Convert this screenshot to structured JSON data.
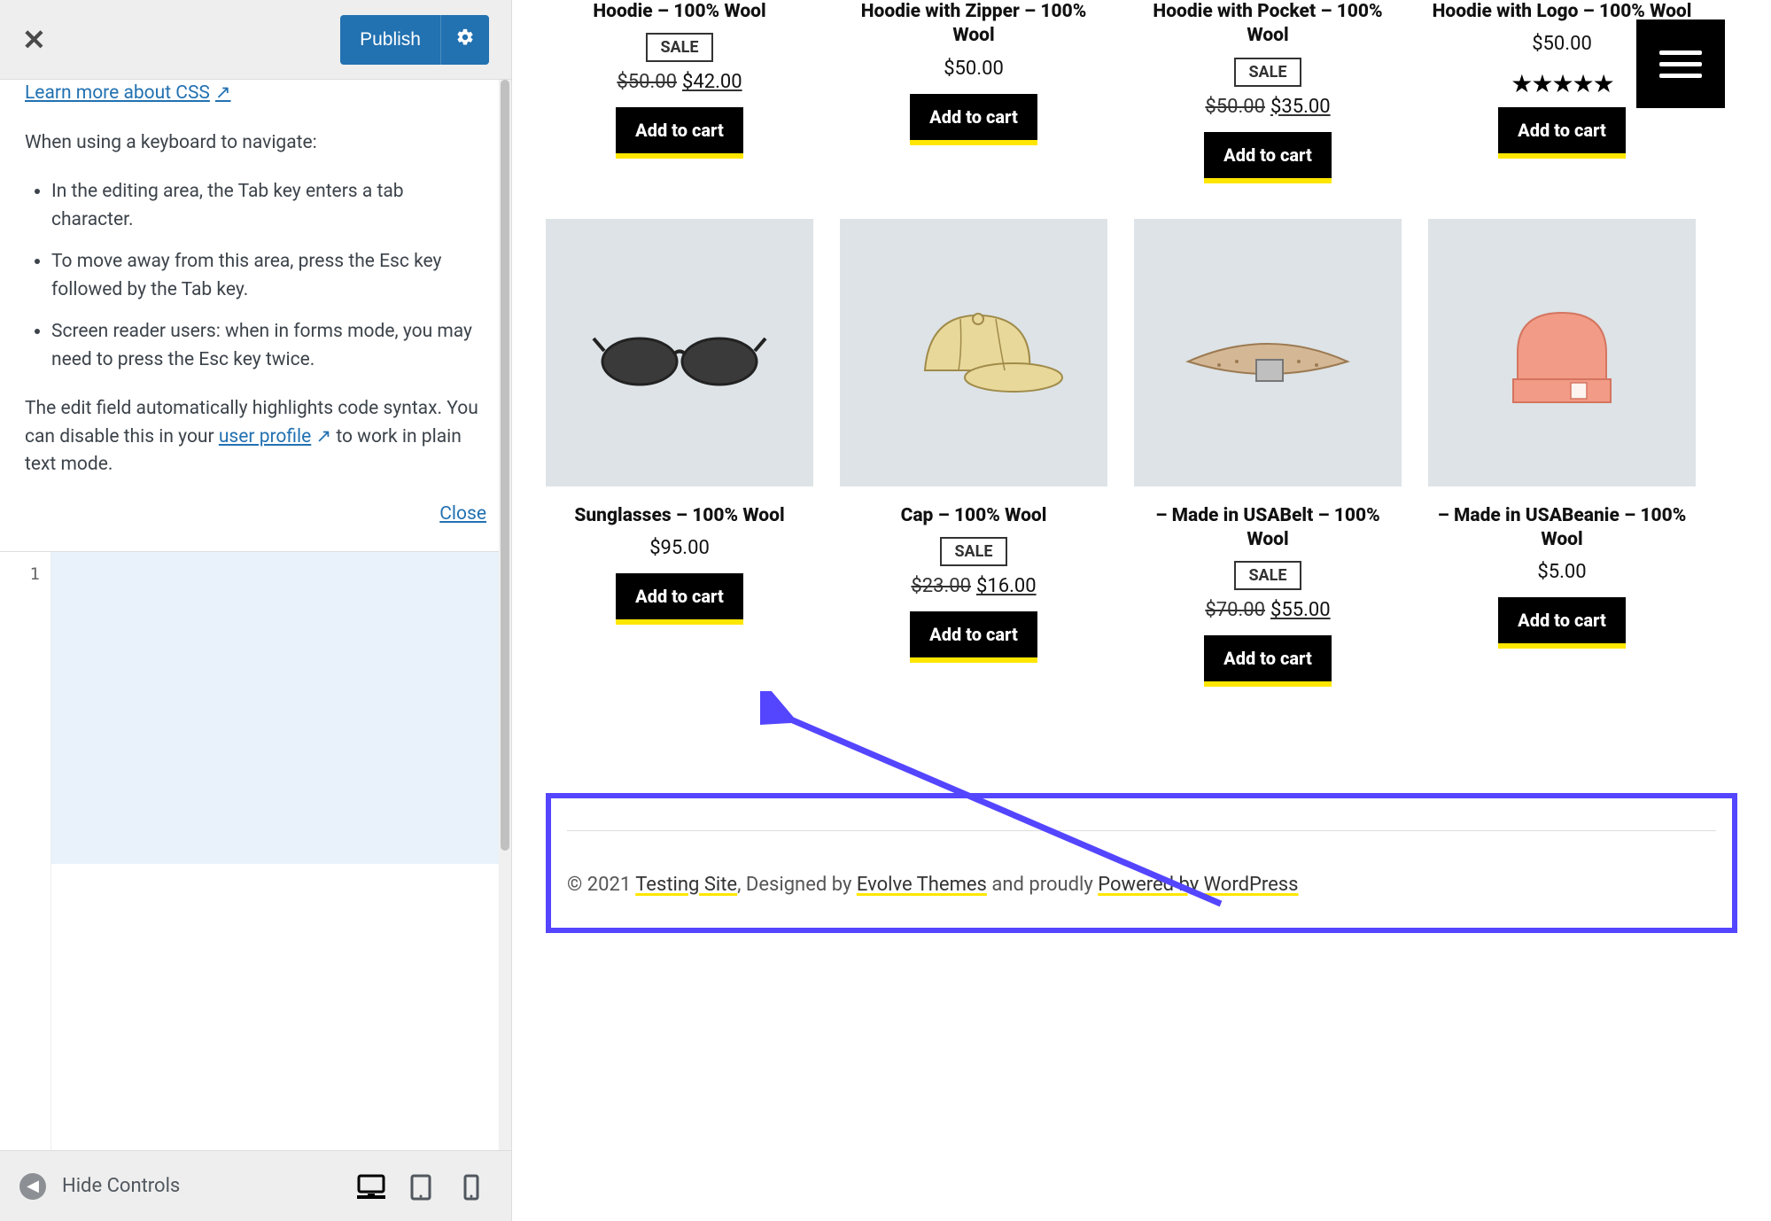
{
  "sidebar": {
    "publish_label": "Publish",
    "learn_label": "Learn more about CSS",
    "intro": "When using a keyboard to navigate:",
    "tips": [
      "In the editing area, the Tab key enters a tab character.",
      "To move away from this area, press the Esc key followed by the Tab key.",
      "Screen reader users: when in forms mode, you may need to press the Esc key twice."
    ],
    "edit_text_prefix": "The edit field automatically highlights code syntax. You can disable this in your ",
    "profile_link": "user profile",
    "edit_text_suffix": " to work in plain text mode.",
    "close_label": "Close",
    "line_no": "1",
    "hide_controls": "Hide Controls"
  },
  "products_row1": [
    {
      "title": "Hoodie – 100% Wool",
      "sale": true,
      "old": "$50.00",
      "new": "$42.00",
      "stars": false,
      "btn": "Add to cart"
    },
    {
      "title": "Hoodie with Zipper – 100% Wool",
      "sale": false,
      "price": "$50.00",
      "stars": false,
      "btn": "Add to cart"
    },
    {
      "title": "Hoodie with Pocket – 100% Wool",
      "sale": true,
      "old": "$50.00",
      "new": "$35.00",
      "stars": false,
      "btn": "Add to cart"
    },
    {
      "title": "Hoodie with Logo – 100% Wool",
      "sale": false,
      "price": "$50.00",
      "stars": true,
      "btn": "Add to cart"
    }
  ],
  "products_row2": [
    {
      "title": "Sunglasses – 100% Wool",
      "sale": false,
      "price": "$95.00",
      "btn": "Add to cart",
      "img": "sunglasses"
    },
    {
      "title": "Cap – 100% Wool",
      "sale": true,
      "old": "$23.00",
      "new": "$16.00",
      "btn": "Add to cart",
      "img": "cap"
    },
    {
      "title": "– Made in USABelt – 100% Wool",
      "sale": true,
      "old": "$70.00",
      "new": "$55.00",
      "btn": "Add to cart",
      "img": "belt"
    },
    {
      "title": "– Made in USABeanie – 100% Wool",
      "sale": false,
      "price": "$5.00",
      "btn": "Add to cart",
      "img": "beanie"
    }
  ],
  "footer": {
    "copyright": "© 2021 ",
    "site": "Testing Site",
    "designed": ", Designed by ",
    "theme": "Evolve Themes",
    "proudly": " and proudly ",
    "powered": "Powered by WordPress"
  }
}
